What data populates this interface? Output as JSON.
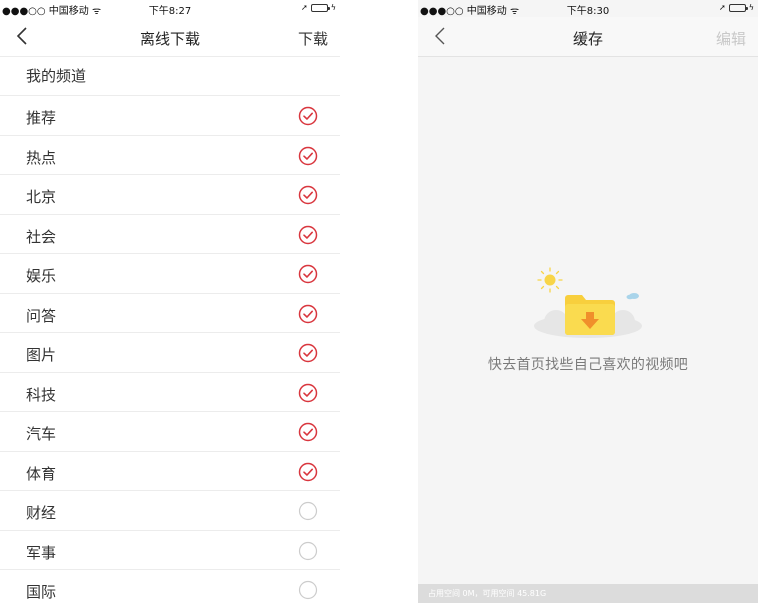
{
  "left_screen": {
    "status_bar": {
      "carrier": "●●●○○ 中国移动 ᯤ",
      "time": "下午8:27"
    },
    "nav": {
      "title": "离线下载",
      "action": "下载"
    },
    "section_title": "我的频道",
    "channels": [
      {
        "label": "推荐",
        "checked": true
      },
      {
        "label": "热点",
        "checked": true
      },
      {
        "label": "北京",
        "checked": true
      },
      {
        "label": "社会",
        "checked": true
      },
      {
        "label": "娱乐",
        "checked": true
      },
      {
        "label": "问答",
        "checked": true
      },
      {
        "label": "图片",
        "checked": true
      },
      {
        "label": "科技",
        "checked": true
      },
      {
        "label": "汽车",
        "checked": true
      },
      {
        "label": "体育",
        "checked": true
      },
      {
        "label": "财经",
        "checked": false
      },
      {
        "label": "军事",
        "checked": false
      },
      {
        "label": "国际",
        "checked": false
      }
    ]
  },
  "right_screen": {
    "status_bar": {
      "carrier": "●●●○○ 中国移动 ᯤ",
      "time": "下午8:30"
    },
    "nav": {
      "title": "缓存",
      "action": "编辑"
    },
    "empty_message": "快去首页找些自己喜欢的视频吧",
    "storage_info": "占用空间 0M，可用空间 45.81G"
  },
  "colors": {
    "accent_red": "#d9363e",
    "unchecked_gray": "#cccccc",
    "folder_yellow": "#f8cf3d",
    "sun_yellow": "#f8d548"
  },
  "icons": {
    "back": "chevron-left-icon",
    "checked": "check-circle-icon",
    "unchecked": "empty-circle-icon",
    "empty_state": "folder-download-cloud-icon"
  }
}
